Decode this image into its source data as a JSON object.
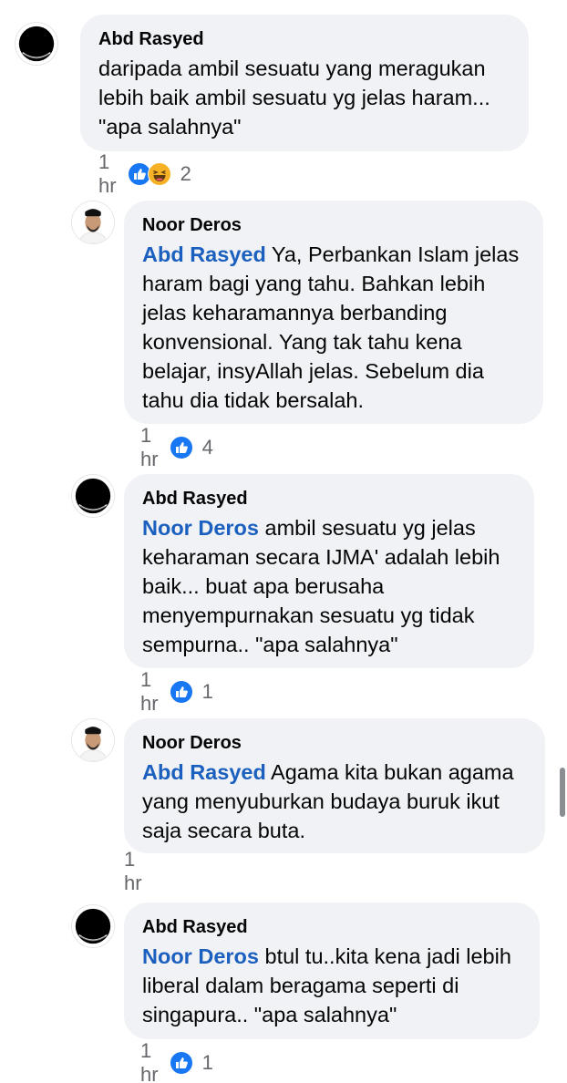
{
  "comments": [
    {
      "author": "Abd Rasyed",
      "mention": "",
      "text": "daripada ambil sesuatu yang meragukan lebih baik ambil sesuatu yg jelas haram... \"apa salahnya\"",
      "time": "1 hr",
      "reaction_count": "2",
      "reactions": [
        "like-icon",
        "haha-icon"
      ]
    },
    {
      "author": "Noor Deros",
      "mention": "Abd Rasyed",
      "text": " Ya, Perbankan Islam jelas haram bagi yang tahu. Bahkan lebih jelas keharamannya berbanding konvensional. Yang tak tahu kena belajar, insyAllah jelas. Sebelum dia tahu dia tidak bersalah.",
      "time": "1 hr",
      "reaction_count": "4",
      "reactions": [
        "like-icon"
      ]
    },
    {
      "author": "Abd Rasyed",
      "mention": "Noor Deros",
      "text": " ambil sesuatu yg jelas keharaman secara IJMA' adalah lebih baik... buat apa berusaha menyempurnakan sesuatu yg tidak sempurna.. \"apa salahnya\"",
      "time": "1 hr",
      "reaction_count": "1",
      "reactions": [
        "like-icon"
      ]
    },
    {
      "author": "Noor Deros",
      "mention": "Abd Rasyed",
      "text": " Agama kita bukan agama yang menyuburkan budaya buruk ikut saja secara buta.",
      "time": "1 hr",
      "reaction_count": "",
      "reactions": []
    },
    {
      "author": "Abd Rasyed",
      "mention": "Noor Deros",
      "text": " btul tu..kita kena jadi lebih liberal dalam beragama seperti di singapura.. \"apa salahnya\"",
      "time": "1 hr",
      "reaction_count": "1",
      "reactions": [
        "like-icon"
      ]
    }
  ],
  "colors": {
    "bubble": "#f0f2f5",
    "mention": "#1b5fbf",
    "meta": "#65676b",
    "like": "#1877f2",
    "haha": "#f7b125"
  }
}
